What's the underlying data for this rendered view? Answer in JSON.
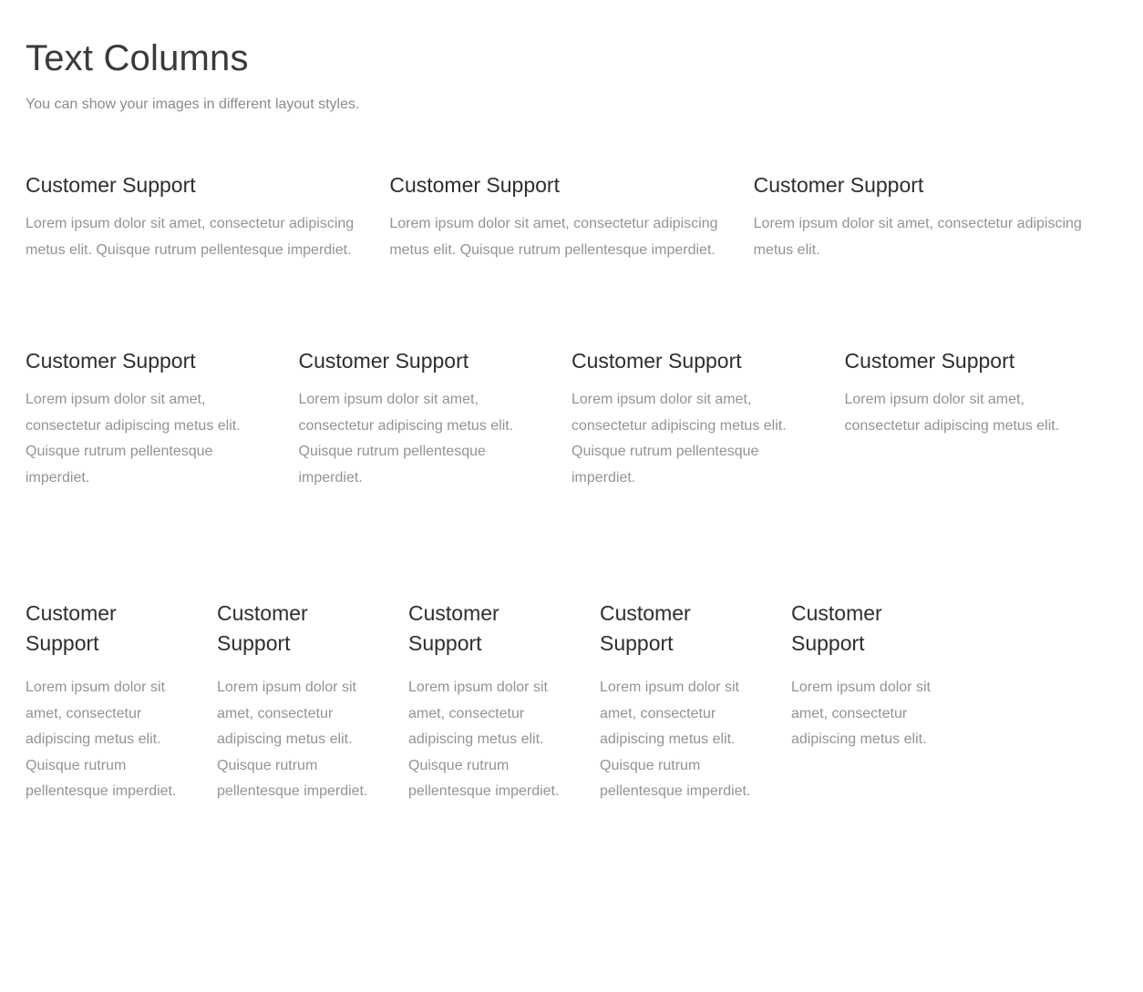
{
  "header": {
    "title": "Text Columns",
    "subtitle": "You can show your images in different layout styles."
  },
  "sections": [
    {
      "id": "three-column-row",
      "columns": [
        {
          "heading": "Customer Support",
          "body": "Lorem ipsum dolor sit amet, consectetur adipiscing metus elit. Quisque rutrum pellentesque imperdiet."
        },
        {
          "heading": "Customer Support",
          "body": "Lorem ipsum dolor sit amet, consectetur adipiscing metus elit. Quisque rutrum pellentesque imperdiet."
        },
        {
          "heading": "Customer Support",
          "body": "Lorem ipsum dolor sit amet, consectetur adipiscing metus elit."
        }
      ]
    },
    {
      "id": "four-column-row",
      "columns": [
        {
          "heading": "Customer Support",
          "body": "Lorem ipsum dolor sit amet, consectetur adipiscing metus elit. Quisque rutrum pellentesque imperdiet."
        },
        {
          "heading": "Customer Support",
          "body": "Lorem ipsum dolor sit amet, consectetur adipiscing metus elit. Quisque rutrum pellentesque imperdiet."
        },
        {
          "heading": "Customer Support",
          "body": "Lorem ipsum dolor sit amet, consectetur adipiscing metus elit. Quisque rutrum pellentesque imperdiet."
        },
        {
          "heading": "Customer Support",
          "body": "Lorem ipsum dolor sit amet, consectetur adipiscing metus elit."
        }
      ]
    },
    {
      "id": "five-column-row",
      "columns": [
        {
          "heading": "Customer Support",
          "body": "Lorem ipsum dolor sit amet, consectetur adipiscing metus elit. Quisque rutrum pellentesque imperdiet."
        },
        {
          "heading": "Customer Support",
          "body": "Lorem ipsum dolor sit amet, consectetur adipiscing metus elit. Quisque rutrum pellentesque imperdiet."
        },
        {
          "heading": "Customer Support",
          "body": "Lorem ipsum dolor sit amet, consectetur adipiscing metus elit. Quisque rutrum pellentesque imperdiet."
        },
        {
          "heading": "Customer Support",
          "body": "Lorem ipsum dolor sit amet, consectetur adipiscing metus elit. Quisque rutrum pellentesque imperdiet."
        },
        {
          "heading": "Customer Support",
          "body": "Lorem ipsum dolor sit amet, consectetur adipiscing metus elit."
        }
      ]
    }
  ],
  "colors": {
    "background": "#ffffff",
    "title": "#3a3a3a",
    "heading": "#2e2e2e",
    "body": "#939393"
  }
}
